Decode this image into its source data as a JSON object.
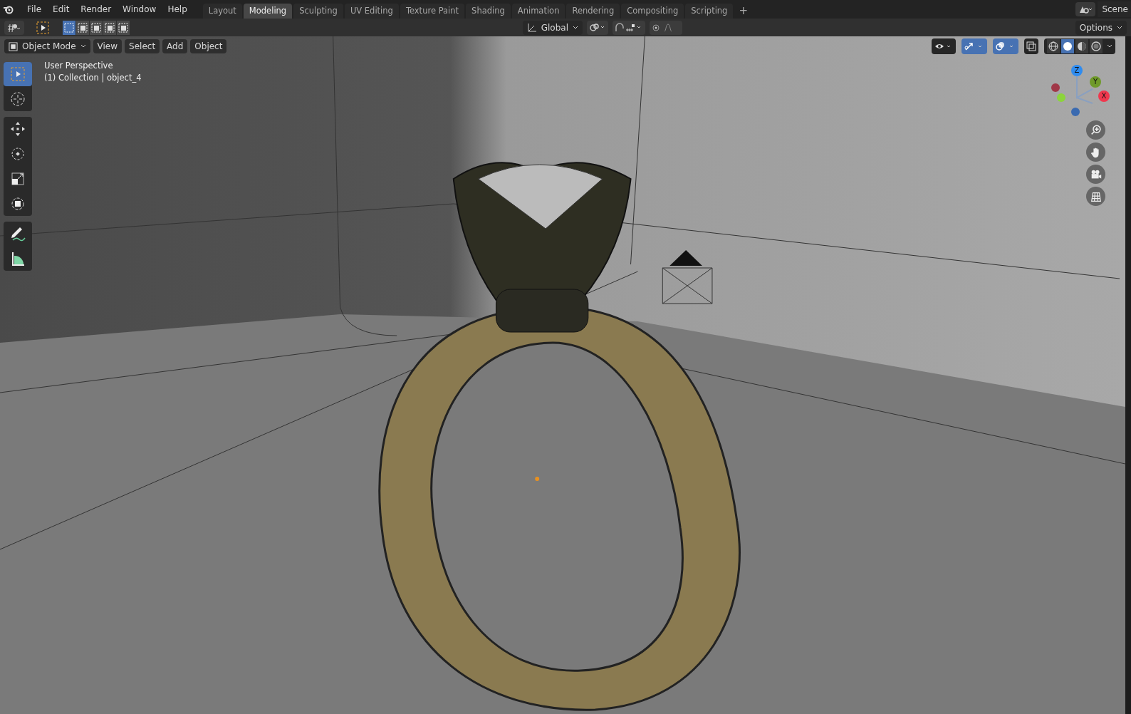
{
  "menu": [
    "File",
    "Edit",
    "Render",
    "Window",
    "Help"
  ],
  "workspace_tabs": [
    {
      "label": "Layout",
      "selected": false
    },
    {
      "label": "Modeling",
      "selected": true
    },
    {
      "label": "Sculpting",
      "selected": false
    },
    {
      "label": "UV Editing",
      "selected": false
    },
    {
      "label": "Texture Paint",
      "selected": false
    },
    {
      "label": "Shading",
      "selected": false
    },
    {
      "label": "Animation",
      "selected": false
    },
    {
      "label": "Rendering",
      "selected": false
    },
    {
      "label": "Compositing",
      "selected": false
    },
    {
      "label": "Scripting",
      "selected": false
    }
  ],
  "add_tab": "+",
  "scene": "Scene",
  "select_modes": [
    {
      "selected": true
    },
    {
      "selected": false
    },
    {
      "selected": false
    },
    {
      "selected": false
    },
    {
      "selected": false
    }
  ],
  "orientation": "Global",
  "snapping": {
    "on": false
  },
  "proportional_editing": {
    "on": false
  },
  "options": "Options",
  "viewport_header": {
    "mode": "Object Mode",
    "menus": [
      "View",
      "Select",
      "Add",
      "Object"
    ]
  },
  "viewport_toggles": [
    {
      "kind": "gizmo",
      "on": true
    },
    {
      "kind": "overlay",
      "on": true
    }
  ],
  "shading_modes": [
    {
      "kind": "wireframe",
      "selected": false
    },
    {
      "kind": "solid",
      "selected": true
    },
    {
      "kind": "material",
      "selected": false
    },
    {
      "kind": "rendered",
      "selected": false
    }
  ],
  "tools": [
    {
      "kind": "select",
      "selected": true
    },
    {
      "kind": "cursor",
      "selected": false
    },
    {
      "kind": "move",
      "selected": false
    },
    {
      "kind": "rotate",
      "selected": false
    },
    {
      "kind": "scale",
      "selected": false
    },
    {
      "kind": "transform",
      "selected": false
    },
    {
      "kind": "annotate",
      "selected": false
    },
    {
      "kind": "measure",
      "selected": false
    }
  ],
  "viewport": {
    "perspective": "User Perspective",
    "collection": "(1) Collection | object_4"
  },
  "axes": [
    {
      "label": "Z",
      "color": "#2f8cf0"
    },
    {
      "label": "Y",
      "color": "#6f9a2a"
    },
    {
      "label": "X",
      "color": "#f0384e"
    }
  ]
}
